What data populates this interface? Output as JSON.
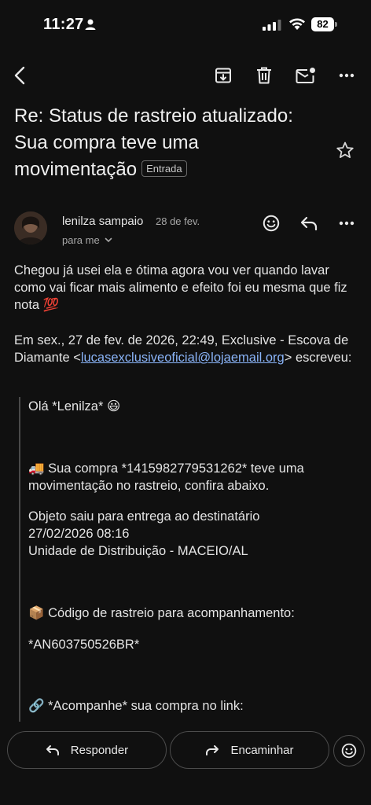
{
  "status_bar": {
    "time": "11:27",
    "battery": "82"
  },
  "email": {
    "subject": "Re: Status de rastreio atualizado: Sua compra teve uma movimentação",
    "label": "Entrada",
    "sender": {
      "name": "lenilza sampaio",
      "date": "28 de fev.",
      "recipients": "para me"
    },
    "body": "Chegou já usei ela e ótima agora vou ver quando lavar como vai ficar mais alimento e efeito foi eu mesma que fiz nota 💯",
    "quote_header": {
      "prefix": "Em sex., 27 de fev. de 2026, 22:49, Exclusive - Escova de Diamante <",
      "email": "lucasexclusiveoficial@lojaemail.org",
      "suffix": "> escreveu:"
    },
    "quoted": {
      "greeting": "Olá *Lenilza* 😃",
      "purchase": "🚚 Sua compra *1415982779531262* teve uma movimentação no rastreio, confira abaixo.",
      "status_line1": "Objeto saiu para entrega ao destinatário",
      "status_line2": "27/02/2026 08:16",
      "status_line3": "Unidade de Distribuição - MACEIO/AL",
      "tracking_label": "📦 Código de rastreio para acompanhamento:",
      "tracking_code": "*AN603750526BR*",
      "link_label": "🔗 *Acompanhe* sua compra no link:"
    }
  },
  "actions": {
    "reply": "Responder",
    "forward": "Encaminhar"
  },
  "icons": [
    "back-icon",
    "archive-icon",
    "delete-icon",
    "mark-unread-icon",
    "more-icon",
    "star-icon",
    "emoji-icon",
    "reply-icon",
    "forward-icon"
  ]
}
